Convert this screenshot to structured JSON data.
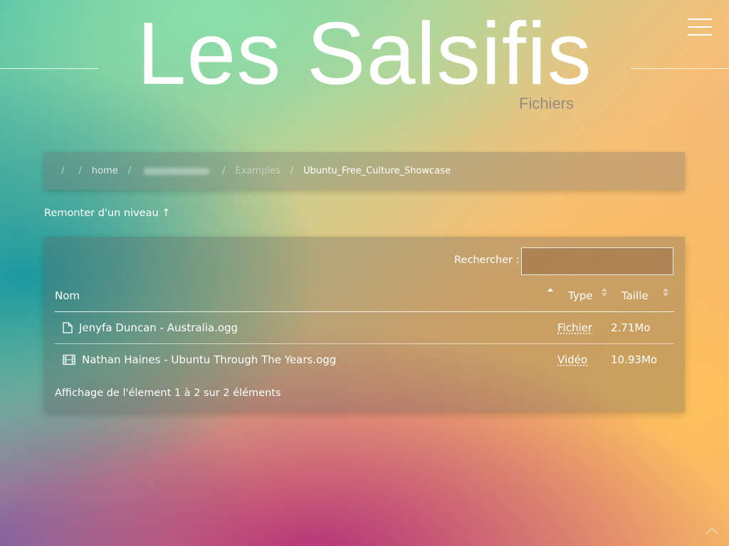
{
  "header": {
    "title": "Les Salsifis",
    "subtitle": "Fichiers"
  },
  "breadcrumb": {
    "items": [
      {
        "label": ""
      },
      {
        "label": "home"
      },
      {
        "label": ""
      },
      {
        "label": "Examples"
      },
      {
        "label": "Ubuntu_Free_Culture_Showcase"
      }
    ]
  },
  "up_link": {
    "label": "Remonter d'un niveau ↑"
  },
  "table": {
    "search_label": "Rechercher :",
    "search_value": "",
    "columns": {
      "name": "Nom",
      "type": "Type",
      "size": "Taille"
    },
    "rows": [
      {
        "icon": "file-icon",
        "name": "Jenyfa Duncan - Australia.ogg",
        "type": "Fichier",
        "size": "2.71Mo"
      },
      {
        "icon": "film-icon",
        "name": "Nathan Haines - Ubuntu Through The Years.ogg",
        "type": "Vidéo",
        "size": "10.93Mo"
      }
    ],
    "info": "Affichage de l'élement 1 à 2 sur 2 éléments"
  },
  "icons": {
    "menu": "hamburger-menu-icon",
    "scroll_top": "chevron-up-icon"
  }
}
